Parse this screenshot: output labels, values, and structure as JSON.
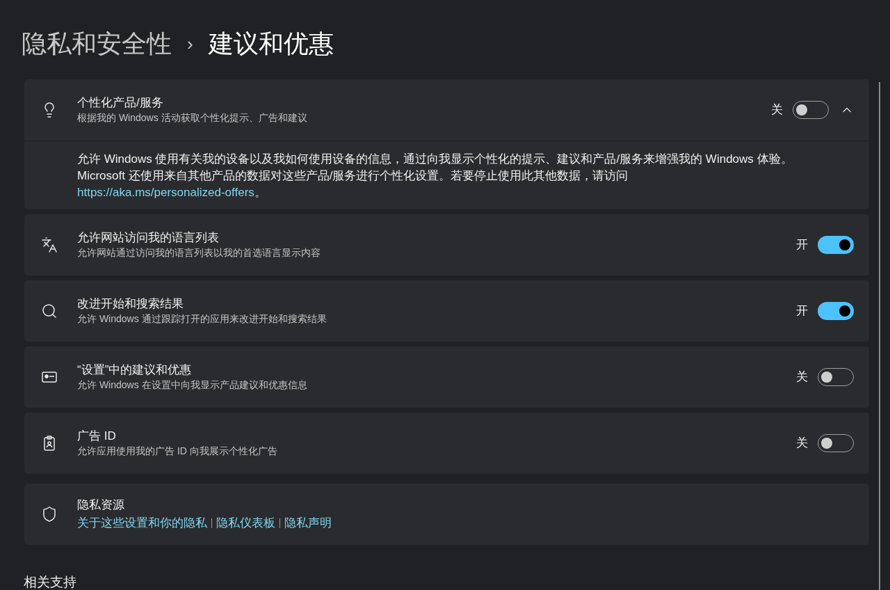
{
  "breadcrumb": {
    "parent": "隐私和安全性",
    "separator": "›",
    "current": "建议和优惠"
  },
  "settings": [
    {
      "kind": "expandable",
      "title": "个性化产品/服务",
      "subtitle": "根据我的 Windows 活动获取个性化提示、广告和建议",
      "state_label": "关",
      "on": false,
      "expanded": true,
      "details": {
        "text": "允许 Windows 使用有关我的设备以及我如何使用设备的信息，通过向我显示个性化的提示、建议和产品/服务来增强我的 Windows 体验。Microsoft 还使用来自其他产品的数据对这些产品/服务进行个性化设置。若要停止使用此其他数据，请访问 ",
        "link": "https://aka.ms/personalized-offers",
        "suffix": "。"
      }
    },
    {
      "kind": "toggle",
      "title": "允许网站访问我的语言列表",
      "subtitle": "允许网站通过访问我的语言列表以我的首选语言显示内容",
      "state_label": "开",
      "on": true
    },
    {
      "kind": "toggle",
      "title": "改进开始和搜索结果",
      "subtitle": "允许 Windows 通过跟踪打开的应用来改进开始和搜索结果",
      "state_label": "开",
      "on": true
    },
    {
      "kind": "toggle",
      "title": "“设置”中的建议和优惠",
      "subtitle": "允许 Windows 在设置中向我显示产品建议和优惠信息",
      "state_label": "关",
      "on": false
    },
    {
      "kind": "toggle",
      "title": "广告 ID",
      "subtitle": "允许应用使用我的广告 ID 向我展示个性化广告",
      "state_label": "关",
      "on": false
    },
    {
      "kind": "links",
      "title": "隐私资源",
      "links": [
        "关于这些设置和你的隐私",
        "隐私仪表板",
        "隐私声明"
      ]
    }
  ],
  "section_heading": "相关支持"
}
